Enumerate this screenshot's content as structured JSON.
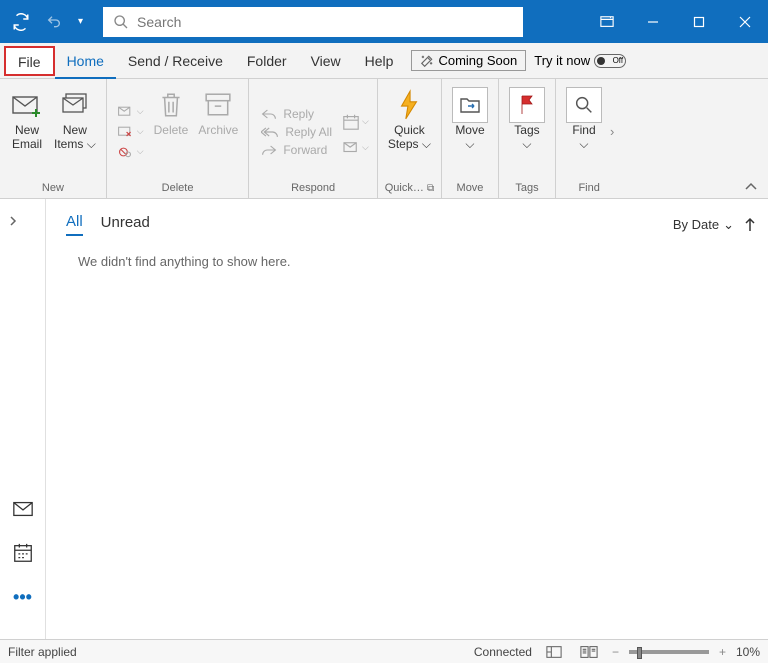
{
  "titlebar": {
    "search_placeholder": "Search"
  },
  "tabs": {
    "file": "File",
    "home": "Home",
    "send_receive": "Send / Receive",
    "folder": "Folder",
    "view": "View",
    "help": "Help",
    "coming_soon": "Coming Soon",
    "try_it": "Try it now",
    "toggle_state": "Off"
  },
  "ribbon": {
    "new_email": "New\nEmail",
    "new_items": "New\nItems",
    "delete": "Delete",
    "archive": "Archive",
    "reply": "Reply",
    "reply_all": "Reply All",
    "forward": "Forward",
    "quick_steps": "Quick\nSteps",
    "move": "Move",
    "tags": "Tags",
    "find": "Find",
    "groups": {
      "new": "New",
      "delete": "Delete",
      "respond": "Respond",
      "quick_steps": "Quick…",
      "move": "Move",
      "tags": "Tags",
      "find": "Find"
    }
  },
  "mail": {
    "filters": {
      "all": "All",
      "unread": "Unread"
    },
    "sort_label": "By Date",
    "empty": "We didn't find anything to show here."
  },
  "status": {
    "filter": "Filter applied",
    "connected": "Connected",
    "zoom": "10%"
  }
}
